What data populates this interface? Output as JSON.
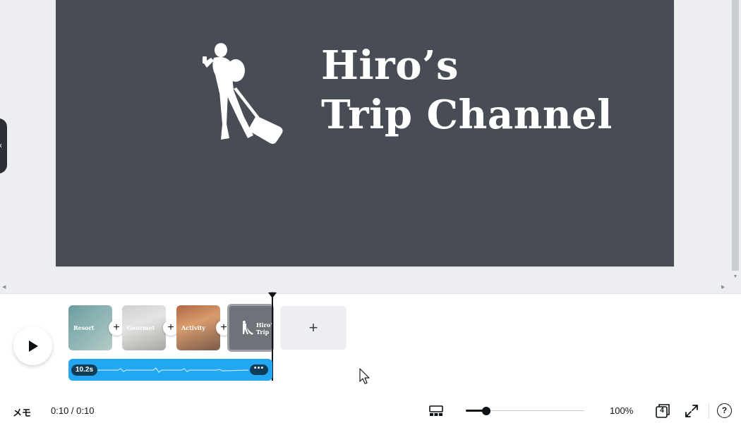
{
  "slide": {
    "title_line_1": "Hiro’s",
    "title_line_2": "Trip Channel",
    "background_color": "#484d55"
  },
  "timeline": {
    "pages": [
      {
        "label": "Resort"
      },
      {
        "label": "Gourmet"
      },
      {
        "label": "Activity"
      },
      {
        "label": "Hiro' Trip"
      }
    ],
    "add_page_icon": "+",
    "add_between_icon": "+",
    "audio": {
      "duration": "10.2s",
      "more_icon": "•••",
      "color": "#22a7f2"
    }
  },
  "bottom_bar": {
    "memo_label": "メモ",
    "timecode": "0:10 / 0:10",
    "zoom_value": "100%",
    "zoom_level": 0.17,
    "page_count": "4",
    "help_icon": "?"
  },
  "icons": {
    "play": "play-icon",
    "grid": "grid-view-icon",
    "fullscreen": "fullscreen-icon",
    "pages": "pages-icon",
    "help": "help-icon",
    "collapse": "chevron-left-icon"
  }
}
